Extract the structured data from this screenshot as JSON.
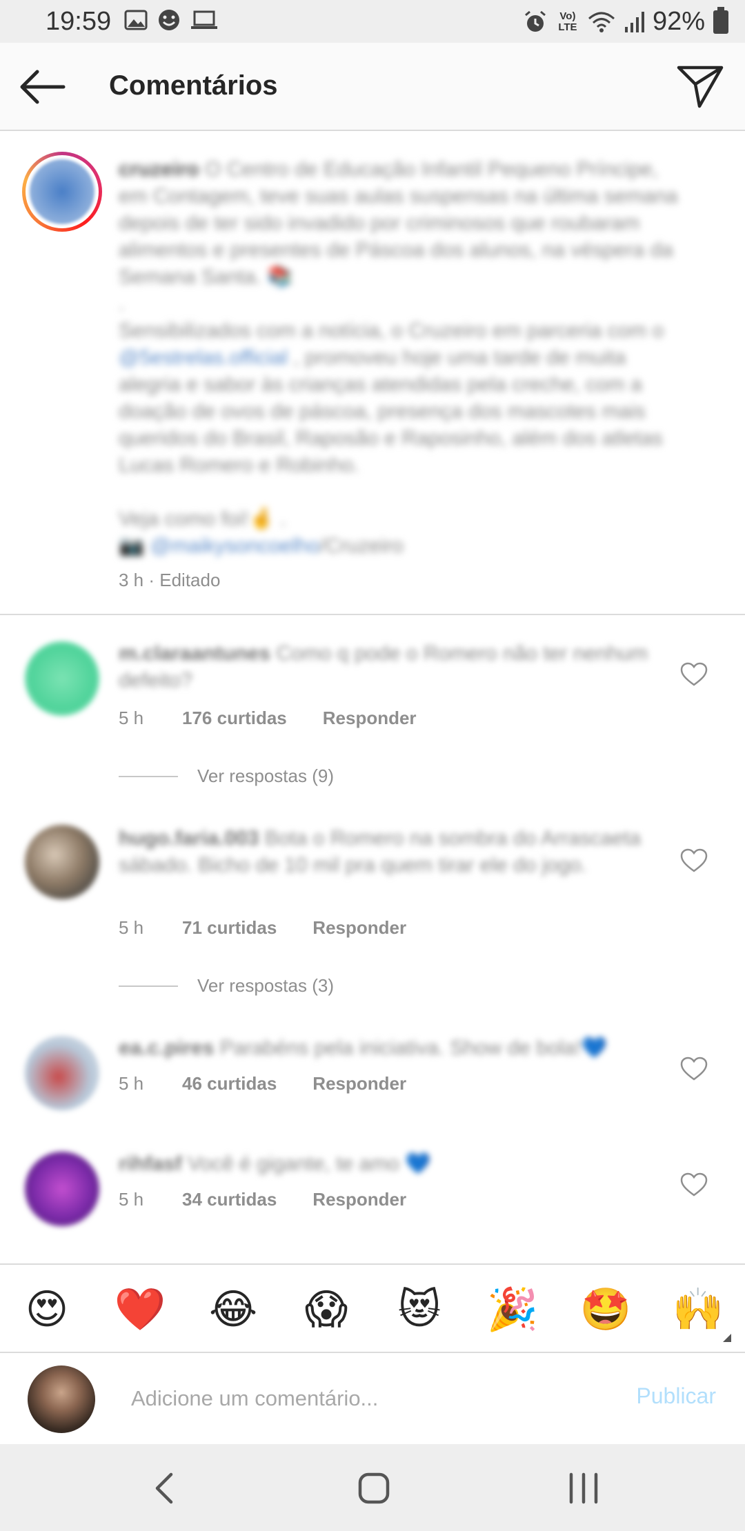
{
  "status_bar": {
    "time": "19:59",
    "network_label": "Vo) LTE",
    "battery": "92%"
  },
  "app_bar": {
    "title": "Comentários"
  },
  "caption": {
    "username": "cruzeiro",
    "paragraphs": [
      "O Centro de Educação Infantil Pequeno Príncipe, em Contagem, teve suas aulas suspensas na última semana depois de ter sido invadido por criminosos que roubaram alimentos e presentes de Páscoa dos alunos, na véspera da Semana Santa. 📚",
      ".",
      "Sensibilizados com a notícia, o Cruzeiro em parceria com o",
      "@5estrelas.official",
      ", promoveu hoje uma tarde de muita alegria e sabor às crianças atendidas pela creche, com a doação de ovos de páscoa, presença dos mascotes mais queridos do Brasil, Raposão e Raposinho, além dos atletas Lucas Romero e Robinho.",
      "Veja como foi!🤞 .",
      "📷 ",
      "@maikysoncoelho",
      "/Cruzeiro"
    ],
    "meta": "3 h · Editado"
  },
  "comments": [
    {
      "username": "m.claraantunes",
      "text": "Como q pode o Romero não ter nenhum defeito?",
      "time": "5 h",
      "likes": "176 curtidas",
      "reply": "Responder",
      "view_replies": "Ver respostas (9)"
    },
    {
      "username": "hugo.faria.003",
      "text": "Bota o Romero na sombra do Arrascaeta sábado. Bicho de 10 mil pra quem tirar ele do jogo.",
      "time": "5 h",
      "likes": "71 curtidas",
      "reply": "Responder",
      "view_replies": "Ver respostas (3)"
    },
    {
      "username": "ea.c.pires",
      "text": "Parabéns pela iniciativa. Show de bola!💙",
      "time": "5 h",
      "likes": "46 curtidas",
      "reply": "Responder"
    },
    {
      "username": "rihfasf",
      "text": "Você é gigante, te amo 💙",
      "time": "5 h",
      "likes": "34 curtidas",
      "reply": "Responder"
    }
  ],
  "emoji_bar": [
    "😍",
    "❤️",
    "😂",
    "😱",
    "😻",
    "🎉",
    "🤩",
    "🙌"
  ],
  "comment_box": {
    "placeholder": "Adicione um comentário...",
    "publish_label": "Publicar"
  },
  "colors": {
    "publish_disabled": "#b2dffc",
    "story_ring_start": "#c13584",
    "story_ring_end": "#fcaf45",
    "heart_red": "#ed2a2a"
  }
}
